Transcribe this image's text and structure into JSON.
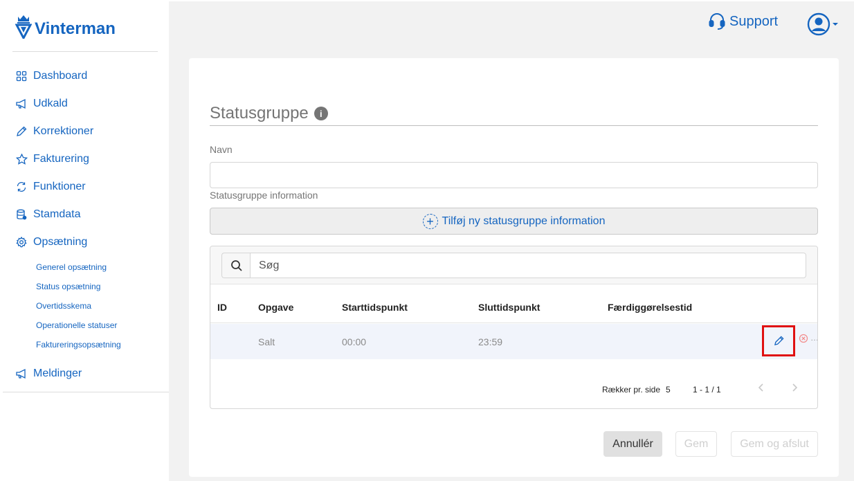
{
  "brand": {
    "name": "Vinterman"
  },
  "colors": {
    "accent": "#1565c0",
    "highlight": "#e01010"
  },
  "sidebar": {
    "items": [
      {
        "label": "Dashboard",
        "icon": "grid-icon"
      },
      {
        "label": "Udkald",
        "icon": "megaphone-icon"
      },
      {
        "label": "Korrektioner",
        "icon": "pencil-icon"
      },
      {
        "label": "Fakturering",
        "icon": "star-icon"
      },
      {
        "label": "Funktioner",
        "icon": "refresh-icon"
      },
      {
        "label": "Stamdata",
        "icon": "database-icon"
      },
      {
        "label": "Opsætning",
        "icon": "gear-icon"
      }
    ],
    "sub_items": [
      "Generel opsætning",
      "Status opsætning",
      "Overtidsskema",
      "Operationelle statuser",
      "Faktureringsopsætning"
    ],
    "last_item": {
      "label": "Meldinger",
      "icon": "megaphone-icon"
    }
  },
  "topbar": {
    "support_label": "Support"
  },
  "form": {
    "title": "Statusgruppe",
    "info_glyph": "i",
    "name_label": "Navn",
    "name_value": "",
    "info_label": "Statusgruppe information",
    "add_button_label": "Tilføj ny statusgruppe information"
  },
  "table": {
    "search_placeholder": "Søg",
    "columns": [
      "ID",
      "Opgave",
      "Starttidspunkt",
      "Sluttidspunkt",
      "Færdiggørelsestid"
    ],
    "rows": [
      {
        "id": "",
        "task": "Salt",
        "start": "00:00",
        "end": "23:59",
        "completion": ""
      }
    ],
    "more_glyph": "…",
    "pager": {
      "rows_per_page_label": "Rækker pr. side",
      "rows_per_page_value": "5",
      "range": "1 - 1 / 1"
    }
  },
  "actions": {
    "cancel": "Annullér",
    "save": "Gem",
    "save_close": "Gem og afslut"
  }
}
